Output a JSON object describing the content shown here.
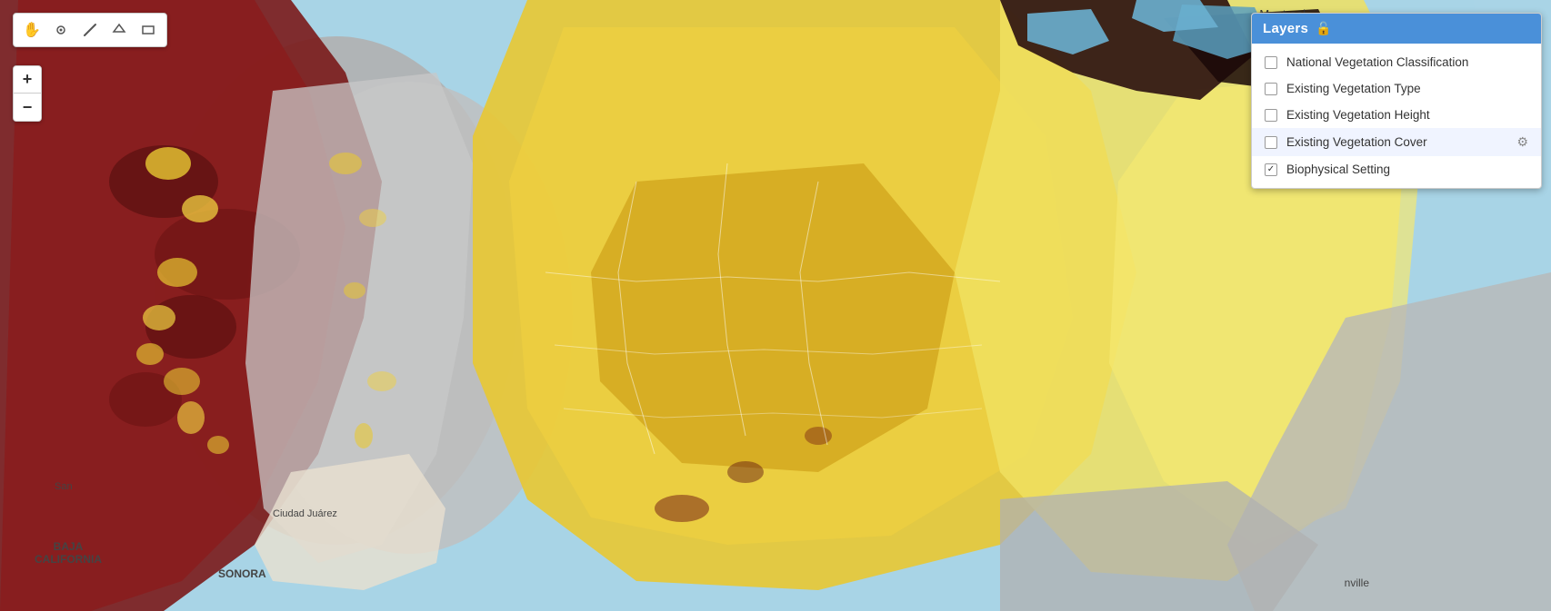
{
  "toolbar": {
    "tools": [
      {
        "name": "pan",
        "icon": "✋",
        "label": "Pan"
      },
      {
        "name": "point",
        "icon": "◎",
        "label": "Point"
      },
      {
        "name": "line",
        "icon": "〰",
        "label": "Line"
      },
      {
        "name": "polygon",
        "icon": "⬠",
        "label": "Polygon"
      },
      {
        "name": "rectangle",
        "icon": "▭",
        "label": "Rectangle"
      }
    ]
  },
  "zoom": {
    "plus_label": "+",
    "minus_label": "−"
  },
  "layers_panel": {
    "title": "Layers",
    "lock_icon": "🔓",
    "items": [
      {
        "label": "National Vegetation Classification",
        "checked": false,
        "has_settings": false,
        "highlighted": false
      },
      {
        "label": "Existing Vegetation Type",
        "checked": false,
        "has_settings": false,
        "highlighted": false
      },
      {
        "label": "Existing Vegetation Height",
        "checked": false,
        "has_settings": false,
        "highlighted": false
      },
      {
        "label": "Existing Vegetation Cover",
        "checked": false,
        "has_settings": true,
        "highlighted": true
      },
      {
        "label": "Biophysical Setting",
        "checked": true,
        "has_settings": false,
        "highlighted": false
      }
    ]
  },
  "map_labels": [
    {
      "text": "Montreal",
      "position": "top-right"
    },
    {
      "text": "San",
      "position": "bottom-left-1"
    },
    {
      "text": "Ciudad Juárez",
      "position": "bottom-center"
    },
    {
      "text": "BAJA\nCALIFORNIA",
      "position": "bottom-left-2"
    },
    {
      "text": "SONORA",
      "position": "bottom-center-2"
    },
    {
      "text": "nville",
      "position": "bottom-right"
    }
  ]
}
